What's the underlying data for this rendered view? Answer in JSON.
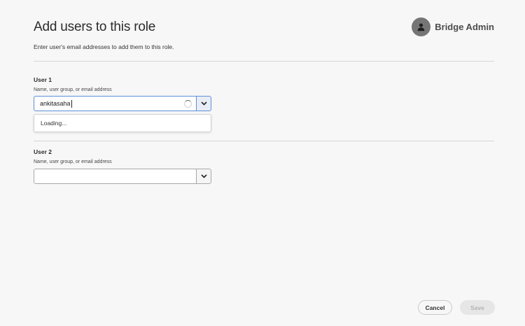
{
  "header": {
    "title": "Add users to this role",
    "subtitle": "Enter user's email addresses to add them to this role.",
    "account_name": "Bridge Admin",
    "avatar_icon": "user-icon"
  },
  "users": [
    {
      "label": "User 1",
      "hint": "Name, user group, or email address",
      "value": "ankitasaha",
      "loading": true,
      "dropdown_status": "Loading..."
    },
    {
      "label": "User 2",
      "hint": "Name, user group, or email address",
      "value": ""
    }
  ],
  "footer": {
    "cancel_label": "Cancel",
    "save_label": "Save",
    "save_enabled": false
  },
  "colors": {
    "background": "#f7f7f7",
    "focus_border": "#5b8fd6",
    "avatar": "#757575"
  }
}
